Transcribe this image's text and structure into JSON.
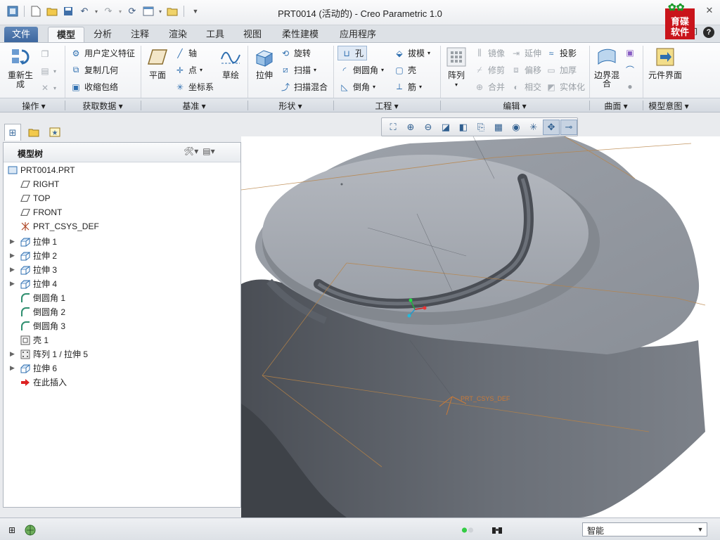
{
  "window": {
    "title": "PRT0014 (活动的) - Creo Parametric 1.0"
  },
  "menu": {
    "tabs": [
      "文件",
      "模型",
      "分析",
      "注释",
      "渲染",
      "工具",
      "视图",
      "柔性建模",
      "应用程序"
    ],
    "active": "模型"
  },
  "ribbon": {
    "operations": {
      "regenerate": "重新生成",
      "label": "操作"
    },
    "get_data": {
      "udf": "用户定义特征",
      "copy_geom": "复制几何",
      "shrinkwrap": "收缩包络",
      "label": "获取数据"
    },
    "datum": {
      "plane": "平面",
      "axis": "轴",
      "point": "点",
      "csys": "坐标系",
      "sketch": "草绘",
      "label": "基准"
    },
    "shapes": {
      "extrude": "拉伸",
      "revolve": "旋转",
      "sweep": "扫描",
      "swept_blend": "扫描混合",
      "label": "形状"
    },
    "engineering": {
      "hole": "孔",
      "round": "倒圆角",
      "chamfer": "倒角",
      "draft": "拔模",
      "shell": "壳",
      "rib": "筋",
      "label": "工程"
    },
    "editing": {
      "pattern": "阵列",
      "mirror": "镜像",
      "trim": "修剪",
      "merge": "合并",
      "extend": "延伸",
      "offset": "偏移",
      "intersect": "相交",
      "project": "投影",
      "thicken": "加厚",
      "solidify": "实体化",
      "label": "编辑"
    },
    "surfaces": {
      "boundary_blend": "边界混合",
      "label": "曲面"
    },
    "model_intent": {
      "component_interface": "元件界面",
      "label": "模型意图"
    }
  },
  "model_tree": {
    "title": "模型树",
    "items": [
      {
        "label": "PRT0014.PRT",
        "icon": "part-icon",
        "expandable": false
      },
      {
        "label": "RIGHT",
        "icon": "datum-plane-icon",
        "expandable": false
      },
      {
        "label": "TOP",
        "icon": "datum-plane-icon",
        "expandable": false
      },
      {
        "label": "FRONT",
        "icon": "datum-plane-icon",
        "expandable": false
      },
      {
        "label": "PRT_CSYS_DEF",
        "icon": "csys-icon",
        "expandable": false
      },
      {
        "label": "拉伸 1",
        "icon": "extrude-icon",
        "expandable": true
      },
      {
        "label": "拉伸 2",
        "icon": "extrude-icon",
        "expandable": true
      },
      {
        "label": "拉伸 3",
        "icon": "extrude-icon",
        "expandable": true
      },
      {
        "label": "拉伸 4",
        "icon": "extrude-icon",
        "expandable": true
      },
      {
        "label": "倒圆角 1",
        "icon": "round-icon",
        "expandable": false
      },
      {
        "label": "倒圆角 2",
        "icon": "round-icon",
        "expandable": false
      },
      {
        "label": "倒圆角 3",
        "icon": "round-icon",
        "expandable": false
      },
      {
        "label": "壳 1",
        "icon": "shell-icon",
        "expandable": false
      },
      {
        "label": "阵列 1 / 拉伸 5",
        "icon": "pattern-icon",
        "expandable": true
      },
      {
        "label": "拉伸 6",
        "icon": "extrude-icon",
        "expandable": true
      },
      {
        "label": "在此插入",
        "icon": "insert-here-arrow-icon",
        "expandable": false
      }
    ]
  },
  "viewport": {
    "csys_label": "PRT_CSYS_DEF"
  },
  "status": {
    "filter": "智能"
  },
  "logo": {
    "line1": "育碟",
    "line2": "软件"
  },
  "colors": {
    "file_tab": "#4a73a9",
    "part": "#7b7f88",
    "datum": "#c08a4a",
    "logo": "#c9141b"
  }
}
